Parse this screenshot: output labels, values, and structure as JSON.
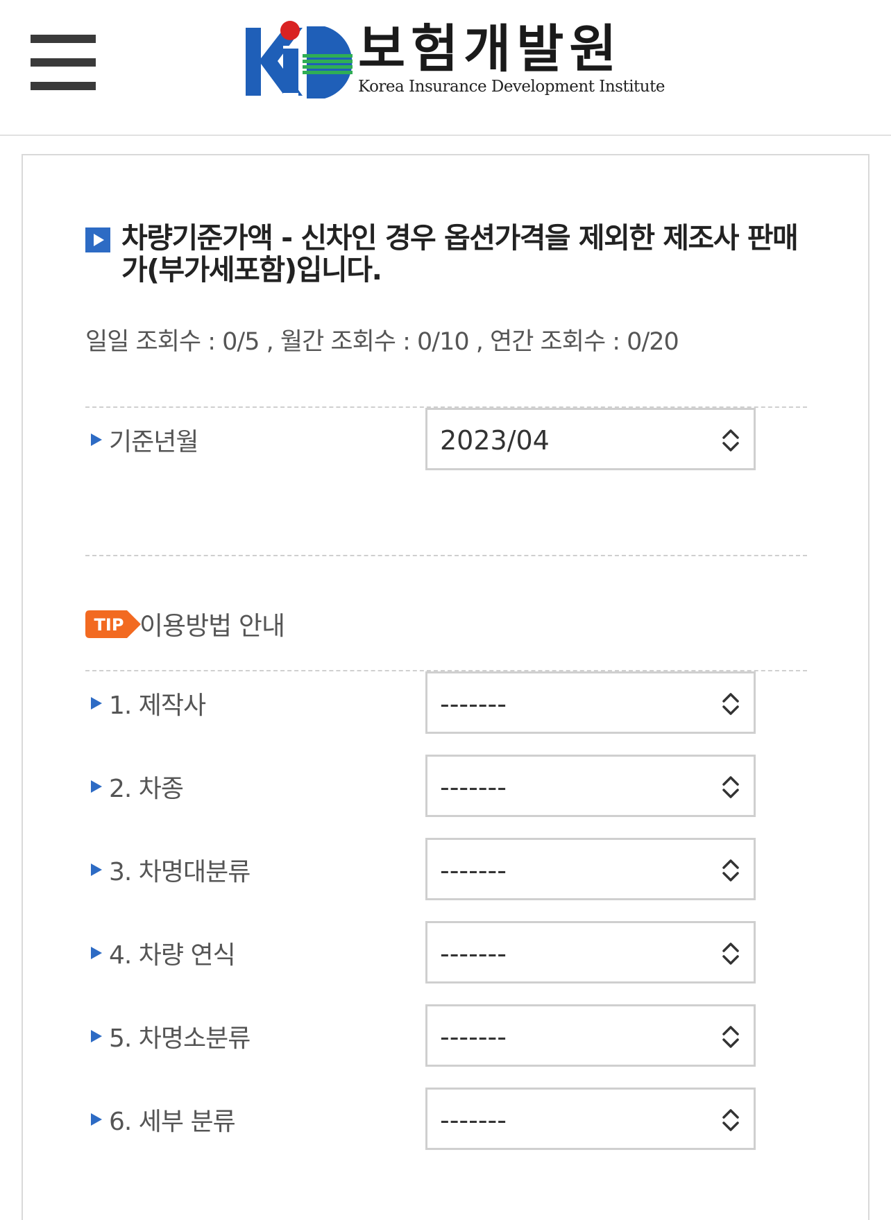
{
  "header": {
    "menu_icon": "hamburger-menu-icon",
    "logo": {
      "name_ko": "보험개발원",
      "name_en": "Korea Insurance Development Institute",
      "colors": {
        "blue": "#1f5fb8",
        "red": "#d92222",
        "green": "#2fae55"
      }
    }
  },
  "notice": {
    "title": "차량기준가액 - 신차인 경우 옵션가격을 제외한 제조사 판매가(부가세포함)입니다.",
    "counts": "일일 조회수 : 0/5 , 월간 조회수 : 0/10 , 연간 조회수 : 0/20"
  },
  "base_month": {
    "label": "기준년월",
    "value": "2023/04"
  },
  "tip": {
    "badge": "TIP",
    "label": "이용방법 안내",
    "badge_color": "#f26a21"
  },
  "fields": [
    {
      "label": "1. 제작사",
      "value": "-------"
    },
    {
      "label": "2. 차종",
      "value": "-------"
    },
    {
      "label": "3. 차명대분류",
      "value": "-------"
    },
    {
      "label": "4. 차량 연식",
      "value": "-------"
    },
    {
      "label": "5. 차명소분류",
      "value": "-------"
    },
    {
      "label": "6. 세부 분류",
      "value": "-------"
    }
  ],
  "accent_color": "#2d6bc4"
}
